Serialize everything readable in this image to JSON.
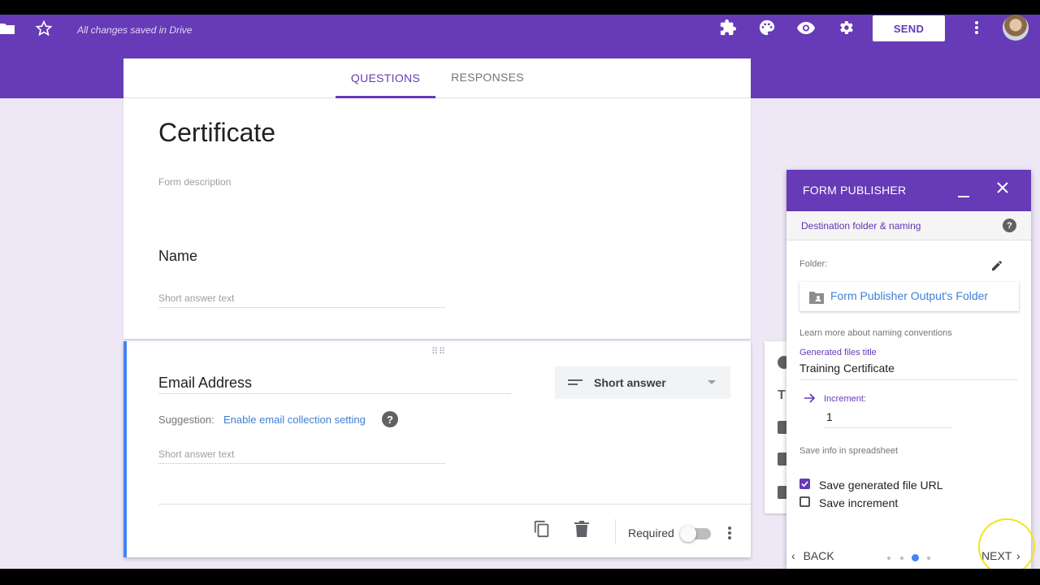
{
  "app": {
    "save_status": "All changes saved in Drive",
    "send_label": "SEND"
  },
  "tabs": [
    {
      "label": "QUESTIONS",
      "active": true
    },
    {
      "label": "RESPONSES",
      "active": false
    }
  ],
  "form": {
    "title": "Certificate",
    "description_placeholder": "Form description",
    "questions": [
      {
        "title": "Name",
        "answer_placeholder": "Short answer text"
      },
      {
        "title": "Email Address",
        "answer_placeholder": "Short answer text",
        "type_label": "Short answer",
        "suggestion_label": "Suggestion:",
        "suggestion_link": "Enable email collection setting",
        "required_label": "Required",
        "required": false
      }
    ]
  },
  "panel": {
    "title": "FORM PUBLISHER",
    "section": "Destination folder & naming",
    "folder_label": "Folder:",
    "folder_name": "Form Publisher Output's Folder",
    "naming_hint": "Learn more about naming conventions",
    "generated_title_label": "Generated files title",
    "generated_title_value": "Training Certificate",
    "increment_label": "Increment:",
    "increment_value": "1",
    "save_info_label": "Save info in spreadsheet",
    "options": [
      {
        "label": "Save generated file URL",
        "checked": true
      },
      {
        "label": "Save increment",
        "checked": false
      }
    ],
    "back_label": "BACK",
    "next_label": "NEXT",
    "steps_total": 4,
    "step_current": 3
  },
  "colors": {
    "brand": "#673ab7",
    "background": "#ede7f6",
    "link": "#3f7fd6",
    "focus_border": "#4285f4"
  },
  "icons": [
    "folder-icon",
    "star-icon",
    "addon-puzzle-icon",
    "palette-icon",
    "preview-eye-icon",
    "settings-gear-icon",
    "more-vert-icon",
    "drag-handle-icon",
    "short-answer-lines-icon",
    "help-icon",
    "duplicate-icon",
    "trash-icon",
    "minimize-icon",
    "close-icon",
    "pencil-icon",
    "shared-folder-icon",
    "arrow-right-icon",
    "chevron-left-icon",
    "chevron-right-icon"
  ]
}
